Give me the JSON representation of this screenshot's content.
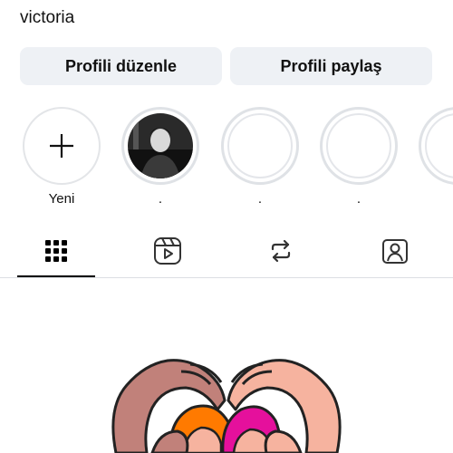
{
  "profile": {
    "username": "victoria"
  },
  "actions": {
    "edit_label": "Profili düzenle",
    "share_label": "Profili paylaş"
  },
  "stories": [
    {
      "label": "Yeni",
      "type": "new",
      "icon": "plus-icon"
    },
    {
      "label": ".",
      "type": "photo"
    },
    {
      "label": ".",
      "type": "empty"
    },
    {
      "label": ".",
      "type": "empty"
    },
    {
      "label": "",
      "type": "empty"
    }
  ],
  "tabs": [
    {
      "icon": "grid-icon",
      "active": true
    },
    {
      "icon": "reels-icon",
      "active": false
    },
    {
      "icon": "repost-icon",
      "active": false
    },
    {
      "icon": "tagged-icon",
      "active": false
    }
  ],
  "colors": {
    "button_bg": "#eef1f5",
    "ring": "#dfe2e6",
    "skin_dark": "#c1817a",
    "skin_light": "#f6b39f",
    "hair_orange": "#ff7a00",
    "hair_magenta": "#e5109c"
  }
}
